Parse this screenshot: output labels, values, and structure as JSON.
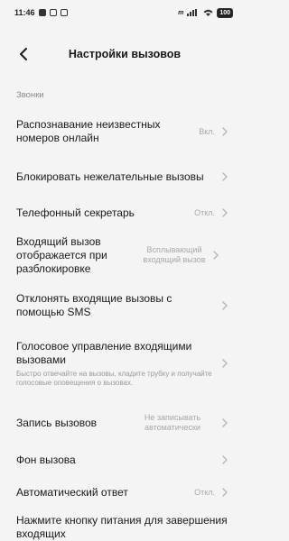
{
  "status_bar": {
    "time": "11:46",
    "network": "m",
    "battery": "100"
  },
  "header": {
    "title": "Настройки вызовов"
  },
  "section": {
    "label": "Звонки"
  },
  "rows": [
    {
      "title": "Распознавание неизвестных номеров онлайн",
      "value": "Вкл."
    },
    {
      "title": "Блокировать нежелательные вызовы",
      "value": ""
    },
    {
      "title": "Телефонный секретарь",
      "value": "Откл."
    },
    {
      "title": "Входящий вызов отображается при разблокировке",
      "value": "Всплывающий входящий вызов"
    },
    {
      "title": "Отклонять входящие вызовы с помощью SMS",
      "value": ""
    },
    {
      "title": "Голосовое управление входящими вызовами",
      "subtitle": "Быстро отвечайте на вызовы, кладите трубку и получайте голосовые оповещения о вызовах.",
      "value": ""
    },
    {
      "title": "Запись вызовов",
      "value": "Не записывать автоматически"
    },
    {
      "title": "Фон вызова",
      "value": ""
    },
    {
      "title": "Автоматический ответ",
      "value": "Откл."
    },
    {
      "title": "Нажмите кнопку питания для завершения входящих",
      "value": ""
    }
  ]
}
